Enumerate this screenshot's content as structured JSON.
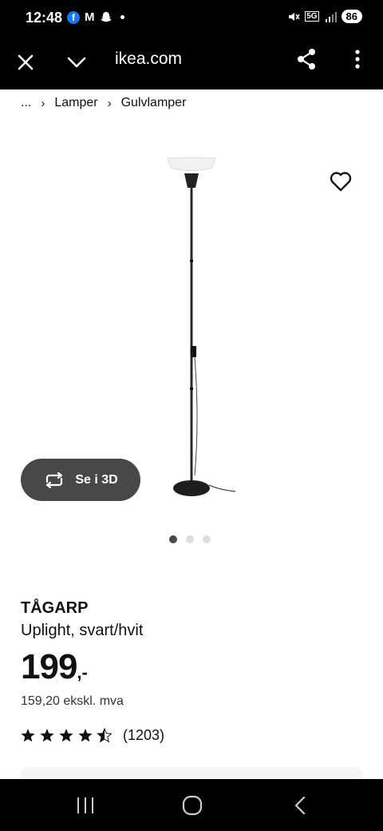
{
  "status_bar": {
    "time": "12:48",
    "app_icons": [
      "facebook-icon",
      "gmail-icon",
      "snapchat-icon"
    ],
    "network": "5G",
    "battery": "86"
  },
  "browser": {
    "url": "ikea.com",
    "icons": [
      "close-icon",
      "chevron-down-icon",
      "share-icon",
      "more-icon"
    ]
  },
  "breadcrumb": {
    "ellipsis": "...",
    "items": [
      "Lamper",
      "Gulvlamper"
    ]
  },
  "gallery": {
    "view_3d_label": "Se i 3D",
    "image_count": 3,
    "active_index": 0
  },
  "product": {
    "name": "TÅGARP",
    "description": "Uplight, svart/hvit",
    "price": "199",
    "price_suffix": ",-",
    "price_ex_vat": "159,20 ekskl. mva",
    "rating": 4.5,
    "rating_max": 5,
    "review_count": "(1203)"
  },
  "colors": {
    "dark_bar": "#000000",
    "button_bg": "#484848",
    "dot_inactive": "#dddddd"
  }
}
